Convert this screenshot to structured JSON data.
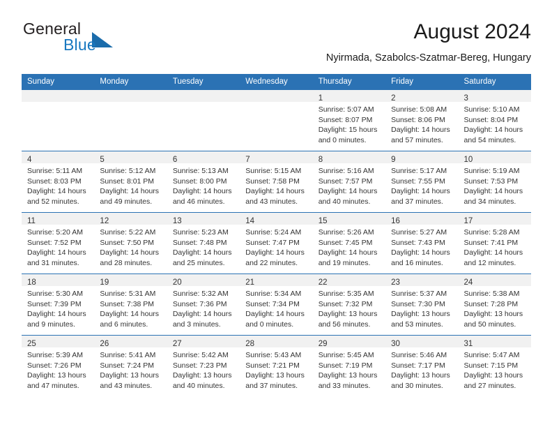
{
  "brand": {
    "name_part1": "General",
    "name_part2": "Blue",
    "logo_icon": "triangle-logo-icon"
  },
  "header": {
    "title": "August 2024",
    "location": "Nyirmada, Szabolcs-Szatmar-Bereg, Hungary"
  },
  "theme": {
    "header_blue": "#2b72b4",
    "band_gray": "#f1f1f1",
    "text_dark": "#333333",
    "brand_blue": "#1878c0"
  },
  "calendar": {
    "weekday_headers": [
      "Sunday",
      "Monday",
      "Tuesday",
      "Wednesday",
      "Thursday",
      "Friday",
      "Saturday"
    ],
    "weeks": [
      [
        {
          "day": "",
          "lines": []
        },
        {
          "day": "",
          "lines": []
        },
        {
          "day": "",
          "lines": []
        },
        {
          "day": "",
          "lines": []
        },
        {
          "day": "1",
          "lines": [
            "Sunrise: 5:07 AM",
            "Sunset: 8:07 PM",
            "Daylight: 15 hours",
            "and 0 minutes."
          ]
        },
        {
          "day": "2",
          "lines": [
            "Sunrise: 5:08 AM",
            "Sunset: 8:06 PM",
            "Daylight: 14 hours",
            "and 57 minutes."
          ]
        },
        {
          "day": "3",
          "lines": [
            "Sunrise: 5:10 AM",
            "Sunset: 8:04 PM",
            "Daylight: 14 hours",
            "and 54 minutes."
          ]
        }
      ],
      [
        {
          "day": "4",
          "lines": [
            "Sunrise: 5:11 AM",
            "Sunset: 8:03 PM",
            "Daylight: 14 hours",
            "and 52 minutes."
          ]
        },
        {
          "day": "5",
          "lines": [
            "Sunrise: 5:12 AM",
            "Sunset: 8:01 PM",
            "Daylight: 14 hours",
            "and 49 minutes."
          ]
        },
        {
          "day": "6",
          "lines": [
            "Sunrise: 5:13 AM",
            "Sunset: 8:00 PM",
            "Daylight: 14 hours",
            "and 46 minutes."
          ]
        },
        {
          "day": "7",
          "lines": [
            "Sunrise: 5:15 AM",
            "Sunset: 7:58 PM",
            "Daylight: 14 hours",
            "and 43 minutes."
          ]
        },
        {
          "day": "8",
          "lines": [
            "Sunrise: 5:16 AM",
            "Sunset: 7:57 PM",
            "Daylight: 14 hours",
            "and 40 minutes."
          ]
        },
        {
          "day": "9",
          "lines": [
            "Sunrise: 5:17 AM",
            "Sunset: 7:55 PM",
            "Daylight: 14 hours",
            "and 37 minutes."
          ]
        },
        {
          "day": "10",
          "lines": [
            "Sunrise: 5:19 AM",
            "Sunset: 7:53 PM",
            "Daylight: 14 hours",
            "and 34 minutes."
          ]
        }
      ],
      [
        {
          "day": "11",
          "lines": [
            "Sunrise: 5:20 AM",
            "Sunset: 7:52 PM",
            "Daylight: 14 hours",
            "and 31 minutes."
          ]
        },
        {
          "day": "12",
          "lines": [
            "Sunrise: 5:22 AM",
            "Sunset: 7:50 PM",
            "Daylight: 14 hours",
            "and 28 minutes."
          ]
        },
        {
          "day": "13",
          "lines": [
            "Sunrise: 5:23 AM",
            "Sunset: 7:48 PM",
            "Daylight: 14 hours",
            "and 25 minutes."
          ]
        },
        {
          "day": "14",
          "lines": [
            "Sunrise: 5:24 AM",
            "Sunset: 7:47 PM",
            "Daylight: 14 hours",
            "and 22 minutes."
          ]
        },
        {
          "day": "15",
          "lines": [
            "Sunrise: 5:26 AM",
            "Sunset: 7:45 PM",
            "Daylight: 14 hours",
            "and 19 minutes."
          ]
        },
        {
          "day": "16",
          "lines": [
            "Sunrise: 5:27 AM",
            "Sunset: 7:43 PM",
            "Daylight: 14 hours",
            "and 16 minutes."
          ]
        },
        {
          "day": "17",
          "lines": [
            "Sunrise: 5:28 AM",
            "Sunset: 7:41 PM",
            "Daylight: 14 hours",
            "and 12 minutes."
          ]
        }
      ],
      [
        {
          "day": "18",
          "lines": [
            "Sunrise: 5:30 AM",
            "Sunset: 7:39 PM",
            "Daylight: 14 hours",
            "and 9 minutes."
          ]
        },
        {
          "day": "19",
          "lines": [
            "Sunrise: 5:31 AM",
            "Sunset: 7:38 PM",
            "Daylight: 14 hours",
            "and 6 minutes."
          ]
        },
        {
          "day": "20",
          "lines": [
            "Sunrise: 5:32 AM",
            "Sunset: 7:36 PM",
            "Daylight: 14 hours",
            "and 3 minutes."
          ]
        },
        {
          "day": "21",
          "lines": [
            "Sunrise: 5:34 AM",
            "Sunset: 7:34 PM",
            "Daylight: 14 hours",
            "and 0 minutes."
          ]
        },
        {
          "day": "22",
          "lines": [
            "Sunrise: 5:35 AM",
            "Sunset: 7:32 PM",
            "Daylight: 13 hours",
            "and 56 minutes."
          ]
        },
        {
          "day": "23",
          "lines": [
            "Sunrise: 5:37 AM",
            "Sunset: 7:30 PM",
            "Daylight: 13 hours",
            "and 53 minutes."
          ]
        },
        {
          "day": "24",
          "lines": [
            "Sunrise: 5:38 AM",
            "Sunset: 7:28 PM",
            "Daylight: 13 hours",
            "and 50 minutes."
          ]
        }
      ],
      [
        {
          "day": "25",
          "lines": [
            "Sunrise: 5:39 AM",
            "Sunset: 7:26 PM",
            "Daylight: 13 hours",
            "and 47 minutes."
          ]
        },
        {
          "day": "26",
          "lines": [
            "Sunrise: 5:41 AM",
            "Sunset: 7:24 PM",
            "Daylight: 13 hours",
            "and 43 minutes."
          ]
        },
        {
          "day": "27",
          "lines": [
            "Sunrise: 5:42 AM",
            "Sunset: 7:23 PM",
            "Daylight: 13 hours",
            "and 40 minutes."
          ]
        },
        {
          "day": "28",
          "lines": [
            "Sunrise: 5:43 AM",
            "Sunset: 7:21 PM",
            "Daylight: 13 hours",
            "and 37 minutes."
          ]
        },
        {
          "day": "29",
          "lines": [
            "Sunrise: 5:45 AM",
            "Sunset: 7:19 PM",
            "Daylight: 13 hours",
            "and 33 minutes."
          ]
        },
        {
          "day": "30",
          "lines": [
            "Sunrise: 5:46 AM",
            "Sunset: 7:17 PM",
            "Daylight: 13 hours",
            "and 30 minutes."
          ]
        },
        {
          "day": "31",
          "lines": [
            "Sunrise: 5:47 AM",
            "Sunset: 7:15 PM",
            "Daylight: 13 hours",
            "and 27 minutes."
          ]
        }
      ]
    ]
  }
}
